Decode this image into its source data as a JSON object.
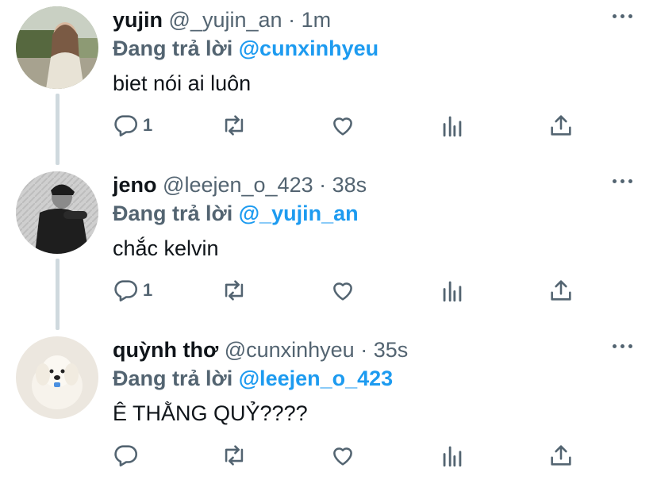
{
  "tweets": [
    {
      "name": "yujin",
      "handle": "@_yujin_an",
      "separator": "·",
      "time": "1m",
      "reply_prefix": "Đang trả lời",
      "reply_to": "@cunxinhyeu",
      "text": "biet nói ai luôn",
      "reply_count": "1",
      "avatar_desc": "avatar-photo-woman-outdoors"
    },
    {
      "name": "jeno",
      "handle": "@leejen_o_423",
      "separator": "·",
      "time": "38s",
      "reply_prefix": "Đang trả lời",
      "reply_to": "@_yujin_an",
      "text": "chắc kelvin",
      "reply_count": "1",
      "avatar_desc": "avatar-photo-man-bw"
    },
    {
      "name": "quỳnh thơ",
      "handle": "@cunxinhyeu",
      "separator": "·",
      "time": "35s",
      "reply_prefix": "Đang trả lời",
      "reply_to": "@leejen_o_423",
      "text": "Ê THẰNG QUỶ????",
      "reply_count": "",
      "avatar_desc": "avatar-photo-plush-dog"
    }
  ],
  "colors": {
    "text": "#0f1419",
    "muted": "#536471",
    "accent": "#1d9bf0",
    "thread_line": "#cfd9de"
  },
  "icons": [
    "reply-icon",
    "retweet-icon",
    "like-icon",
    "analytics-icon",
    "share-icon",
    "more-icon"
  ]
}
